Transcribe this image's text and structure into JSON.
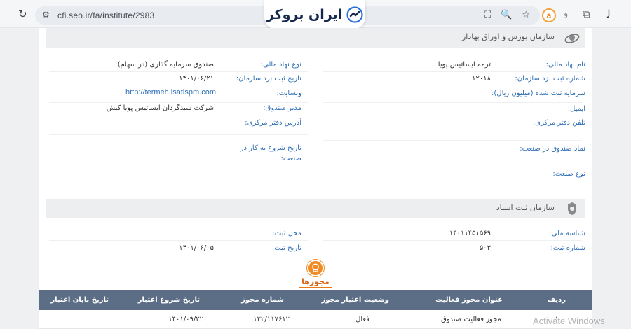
{
  "browser": {
    "url": "cfi.seo.ir/fa/institute/2983",
    "reload_icon": "↻",
    "site_icon": "⚙",
    "translate_icon": "⛶",
    "zoom_icon": "🔍",
    "star_icon": "☆",
    "ext_a_label": "a",
    "ext_b_label": "ﻭ",
    "puzzle_icon": "⧉",
    "profile_icon": "ﻟ"
  },
  "logo": {
    "text": "ایران بروکر"
  },
  "colors": {
    "accent": "#2f6fb6",
    "table_header": "#5b6e86",
    "permit_orange": "#f08a24"
  },
  "section1": {
    "title": "سازمان بورس و اوراق بهادار",
    "right": [
      {
        "label": "نام نهاد مالی:",
        "value": "ترمه ایساتیس پویا"
      },
      {
        "label": "شماره ثبت نزد سازمان:",
        "value": "۱۲۰۱۸"
      },
      {
        "label": "سرمایه ثبت شده (میلیون ریال):",
        "value": ""
      },
      {
        "label": "ایمیل:",
        "value": ""
      },
      {
        "label": "تلفن دفتر مرکزی:",
        "value": ""
      },
      {
        "label": "نماد صندوق در صنعت:",
        "value": ""
      },
      {
        "label": "نوع صنعت:",
        "value": ""
      }
    ],
    "left": [
      {
        "label": "نوع نهاد مالی:",
        "value": "صندوق سرمایه گذاری (در سهام)"
      },
      {
        "label": "تاریخ ثبت نزد سازمان:",
        "value": "۱۴۰۱/۰۶/۲۱"
      },
      {
        "label": "وبسایت:",
        "value": "http://termeh.isatispm.com"
      },
      {
        "label": "مدیر صندوق:",
        "value": "شرکت سبدگردان ایساتیس پویا کیش"
      },
      {
        "label": "آدرس دفتر مرکزی:",
        "value": ""
      },
      {
        "label": "تاریخ شروع به کار در صنعت:",
        "value": ""
      }
    ]
  },
  "section2": {
    "title": "سازمان ثبت اسناد",
    "right": [
      {
        "label": "شناسه ملی:",
        "value": "۱۴۰۱۱۴۵۱۵۶۹"
      },
      {
        "label": "شماره ثبت:",
        "value": "۵۰۳"
      }
    ],
    "left": [
      {
        "label": "محل ثبت:",
        "value": ""
      },
      {
        "label": "تاریخ ثبت:",
        "value": "۱۴۰۱/۰۶/۰۵"
      }
    ]
  },
  "permits": {
    "title": "مجوزها",
    "headers": [
      "ردیف",
      "عنوان مجوز فعالیت",
      "وضعیت اعتبار مجوز",
      "شماره مجوز",
      "تاریخ شروع اعتبار",
      "تاریخ پایان اعتبار"
    ],
    "rows": [
      [
        "۱",
        "مجوز فعالیت صندوق",
        "فعال",
        "۱۲۲/۱۱۷۶۱۲",
        "۱۴۰۱/۰۹/۲۲",
        ""
      ]
    ]
  },
  "watermark": "Activate Windows"
}
